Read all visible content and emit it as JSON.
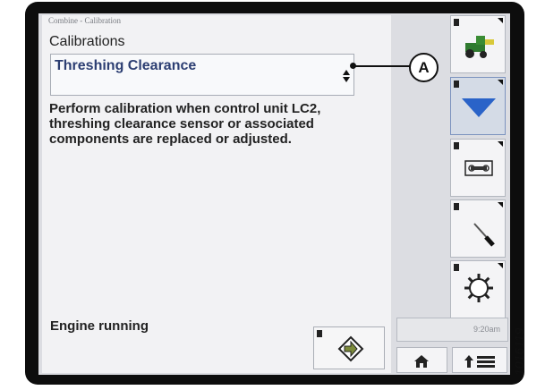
{
  "screen": {
    "breadcrumb": "Combine - Calibration",
    "title": "Calibrations",
    "selected_calibration": "Threshing Clearance",
    "description": "Perform calibration when control unit LC2, threshing clearance sensor or associated components are replaced or adjusted.",
    "status": "Engine running",
    "clock": "9:20am"
  },
  "callout": {
    "label": "A"
  },
  "figure_id": "1016119",
  "sidebar": {
    "buttons": [
      {
        "name": "combine-icon"
      },
      {
        "name": "down-arrow-icon",
        "active": true
      },
      {
        "name": "wrench-icon"
      },
      {
        "name": "screwdriver-icon"
      },
      {
        "name": "gear-icon"
      }
    ]
  },
  "colors": {
    "active_blue": "#2a63c8",
    "bezel": "#0d0d0d"
  }
}
